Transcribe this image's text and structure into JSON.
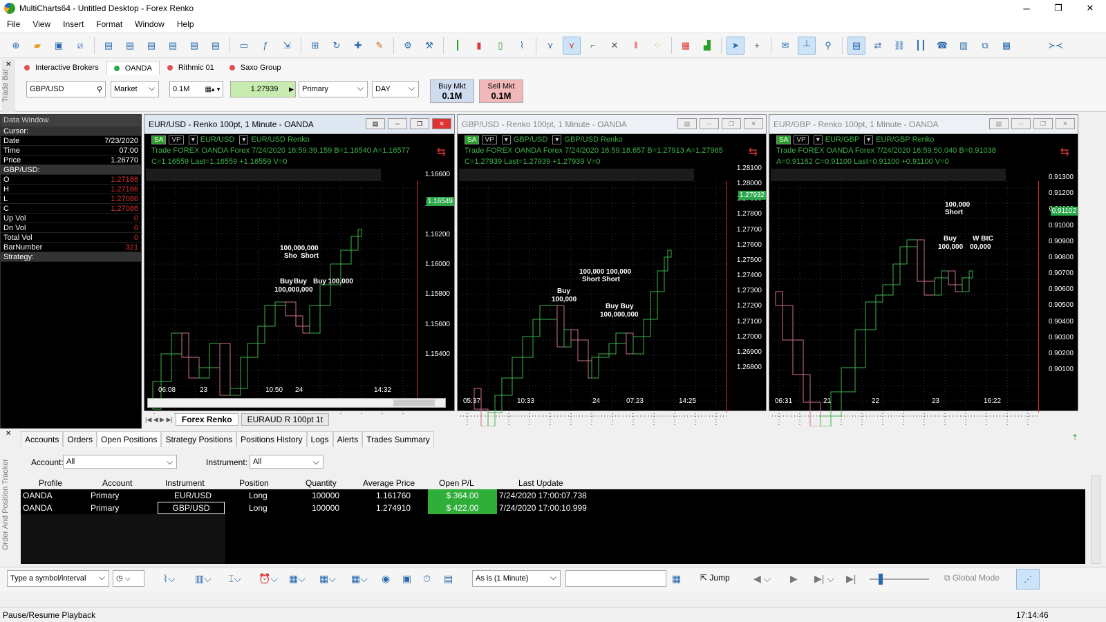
{
  "app": {
    "title": "MultiCharts64 - Untitled Desktop - Forex Renko"
  },
  "menu": [
    "File",
    "View",
    "Insert",
    "Format",
    "Window",
    "Help"
  ],
  "tradebar": {
    "label": "Trade Bar",
    "brokers": [
      "Interactive Brokers",
      "OANDA",
      "Rithmic 01",
      "Saxo Group"
    ],
    "symbol": "GBP/USD",
    "order_type": "Market",
    "quantity": "0.1M",
    "price": "1.27939",
    "account": "Primary",
    "tif": "DAY",
    "buy_label": "Buy Mkt",
    "buy_qty": "0.1M",
    "sell_label": "Sell Mkt",
    "sell_qty": "0.1M"
  },
  "data_window": {
    "title": "Data Window",
    "cursor": "Cursor:",
    "date_label": "Date",
    "date": "7/23/2020",
    "time_label": "Time",
    "time": "07:00",
    "price_label": "Price",
    "price": "1.26770",
    "symbol": "GBP/USD:",
    "o_label": "O",
    "o": "1.27186",
    "h_label": "H",
    "h": "1.27186",
    "l_label": "L",
    "l": "1.27086",
    "c_label": "C",
    "c": "1.27086",
    "upvol_label": "Up Vol",
    "upvol": "0",
    "dnvol_label": "Dn Vol",
    "dnvol": "0",
    "totvol_label": "Total Vol",
    "totvol": "0",
    "bar_label": "BarNumber",
    "bar": "321",
    "strategy": "Strategy:"
  },
  "charts": [
    {
      "title": "EUR/USD - Renko 100pt, 1 Minute - OANDA",
      "sa": "SA",
      "vp": "VP",
      "sym1": "EUR/USD",
      "sym2": "EUR/USD",
      "type": "Renko",
      "line1": "Trade  FOREX  OANDA  Forex  7/24/2020  16:59:39.159  B=1.16540  A=1.16577",
      "line2a": "C=1.16559  Last=1.16559",
      "line2b": "+1.16559",
      "line2c": "V=0",
      "yticks": [
        "1.16600",
        "1.16400",
        "1.16200",
        "1.16000",
        "1.15800",
        "1.15600",
        "1.15400"
      ],
      "xticks": [
        "06:08",
        "23",
        "10:50",
        "24",
        "14:32"
      ],
      "last": "1.16549",
      "chart_data": {
        "type": "line",
        "x": [
          "06:08",
          "23",
          "10:50",
          "24",
          "14:32"
        ],
        "ylim": [
          1.153,
          1.168
        ]
      }
    },
    {
      "title": "GBP/USD - Renko 100pt, 1 Minute - OANDA",
      "sa": "SA",
      "vp": "VP",
      "sym1": "GBP/USD",
      "sym2": "GBP/USD",
      "type": "Renko",
      "line1": "Trade  FOREX  OANDA  Forex  7/24/2020  16:59:18.657  B=1.27913  A=1.27965",
      "line2a": "C=1.27939  Last=1.27939",
      "line2b": "+1.27939",
      "line2c": "V=0",
      "yticks": [
        "1.28100",
        "1.28000",
        "1.27900",
        "1.27800",
        "1.27700",
        "1.27600",
        "1.27500",
        "1.27400",
        "1.27300",
        "1.27200",
        "1.27100",
        "1.27000",
        "1.26900",
        "1.26800"
      ],
      "xticks": [
        "05:37",
        "10:33",
        "24",
        "07:23",
        "14:25"
      ],
      "last": "1.27932",
      "chart_data": {
        "type": "line",
        "x": [
          "05:37",
          "10:33",
          "24",
          "07:23",
          "14:25"
        ],
        "ylim": [
          1.267,
          1.2815
        ]
      }
    },
    {
      "title": "EUR/GBP - Renko 100pt, 1 Minute - OANDA",
      "sa": "SA",
      "vp": "VP",
      "sym1": "EUR/GBP",
      "sym2": "EUR/GBP",
      "type": "Renko",
      "line1": "Trade  FOREX  OANDA  Forex  7/24/2020  16:59:50.040  B=0.91038",
      "line2a": "A=0.91162  C=0.91100  Last=0.91100",
      "line2b": "+0.91100",
      "line2c": "V=0",
      "yticks": [
        "0.91300",
        "0.91200",
        "0.91100",
        "0.91000",
        "0.90900",
        "0.90800",
        "0.90700",
        "0.90600",
        "0.90500",
        "0.90400",
        "0.90300",
        "0.90200",
        "0.90100"
      ],
      "xticks": [
        "06:31",
        "21",
        "22",
        "23",
        "16:22"
      ],
      "last": "0.91102",
      "chart_data": {
        "type": "line",
        "x": [
          "06:31",
          "21",
          "22",
          "23",
          "16:22"
        ],
        "ylim": [
          0.9005,
          0.9137
        ]
      }
    }
  ],
  "annotations": {
    "a1": "100,000",
    "a2": "Short",
    "a3": "Buy",
    "a4": "100,000,000",
    "a5": "Sho",
    "a6": "Buy 100,000",
    "b1": "100,000 100,000",
    "b2": "Short  Short",
    "b3": "Buy",
    "b4": "100,000",
    "b5": "Buy Buy",
    "b6": "100,000,000",
    "c1": "100,000",
    "c2": "Short",
    "c3": "Buy",
    "c4": "100,000",
    "c5": "W BtC",
    "c6": "00,000"
  },
  "workspace_tabs": [
    "Forex Renko",
    "EURAUD R 100pt 1t"
  ],
  "tracker": {
    "label": "Order And Position Tracker",
    "tabs": [
      "Accounts",
      "Orders",
      "Open Positions",
      "Strategy Positions",
      "Positions History",
      "Logs",
      "Alerts",
      "Trades Summary"
    ],
    "account_label": "Account:",
    "account_value": "All",
    "instrument_label": "Instrument:",
    "instrument_value": "All",
    "columns": [
      "Profile",
      "Account",
      "Instrument",
      "Position",
      "Quantity",
      "Average Price",
      "Open P/L",
      "Last Update"
    ],
    "rows": [
      [
        "OANDA",
        "Primary",
        "EUR/USD",
        "Long",
        "100000",
        "1.161760",
        "$ 364.00",
        "7/24/2020 17:00:07.738"
      ],
      [
        "OANDA",
        "Primary",
        "GBP/USD",
        "Long",
        "100000",
        "1.274910",
        "$ 422.00",
        "7/24/2020 17:00:10.999"
      ]
    ]
  },
  "bottom": {
    "symbol_placeholder": "Type a symbol/interval",
    "playback_mode": "As is (1 Minute)",
    "jump": "Jump",
    "global_mode": "Global Mode"
  },
  "status": {
    "text": "Pause/Resume Playback",
    "time": "17:14:46"
  }
}
